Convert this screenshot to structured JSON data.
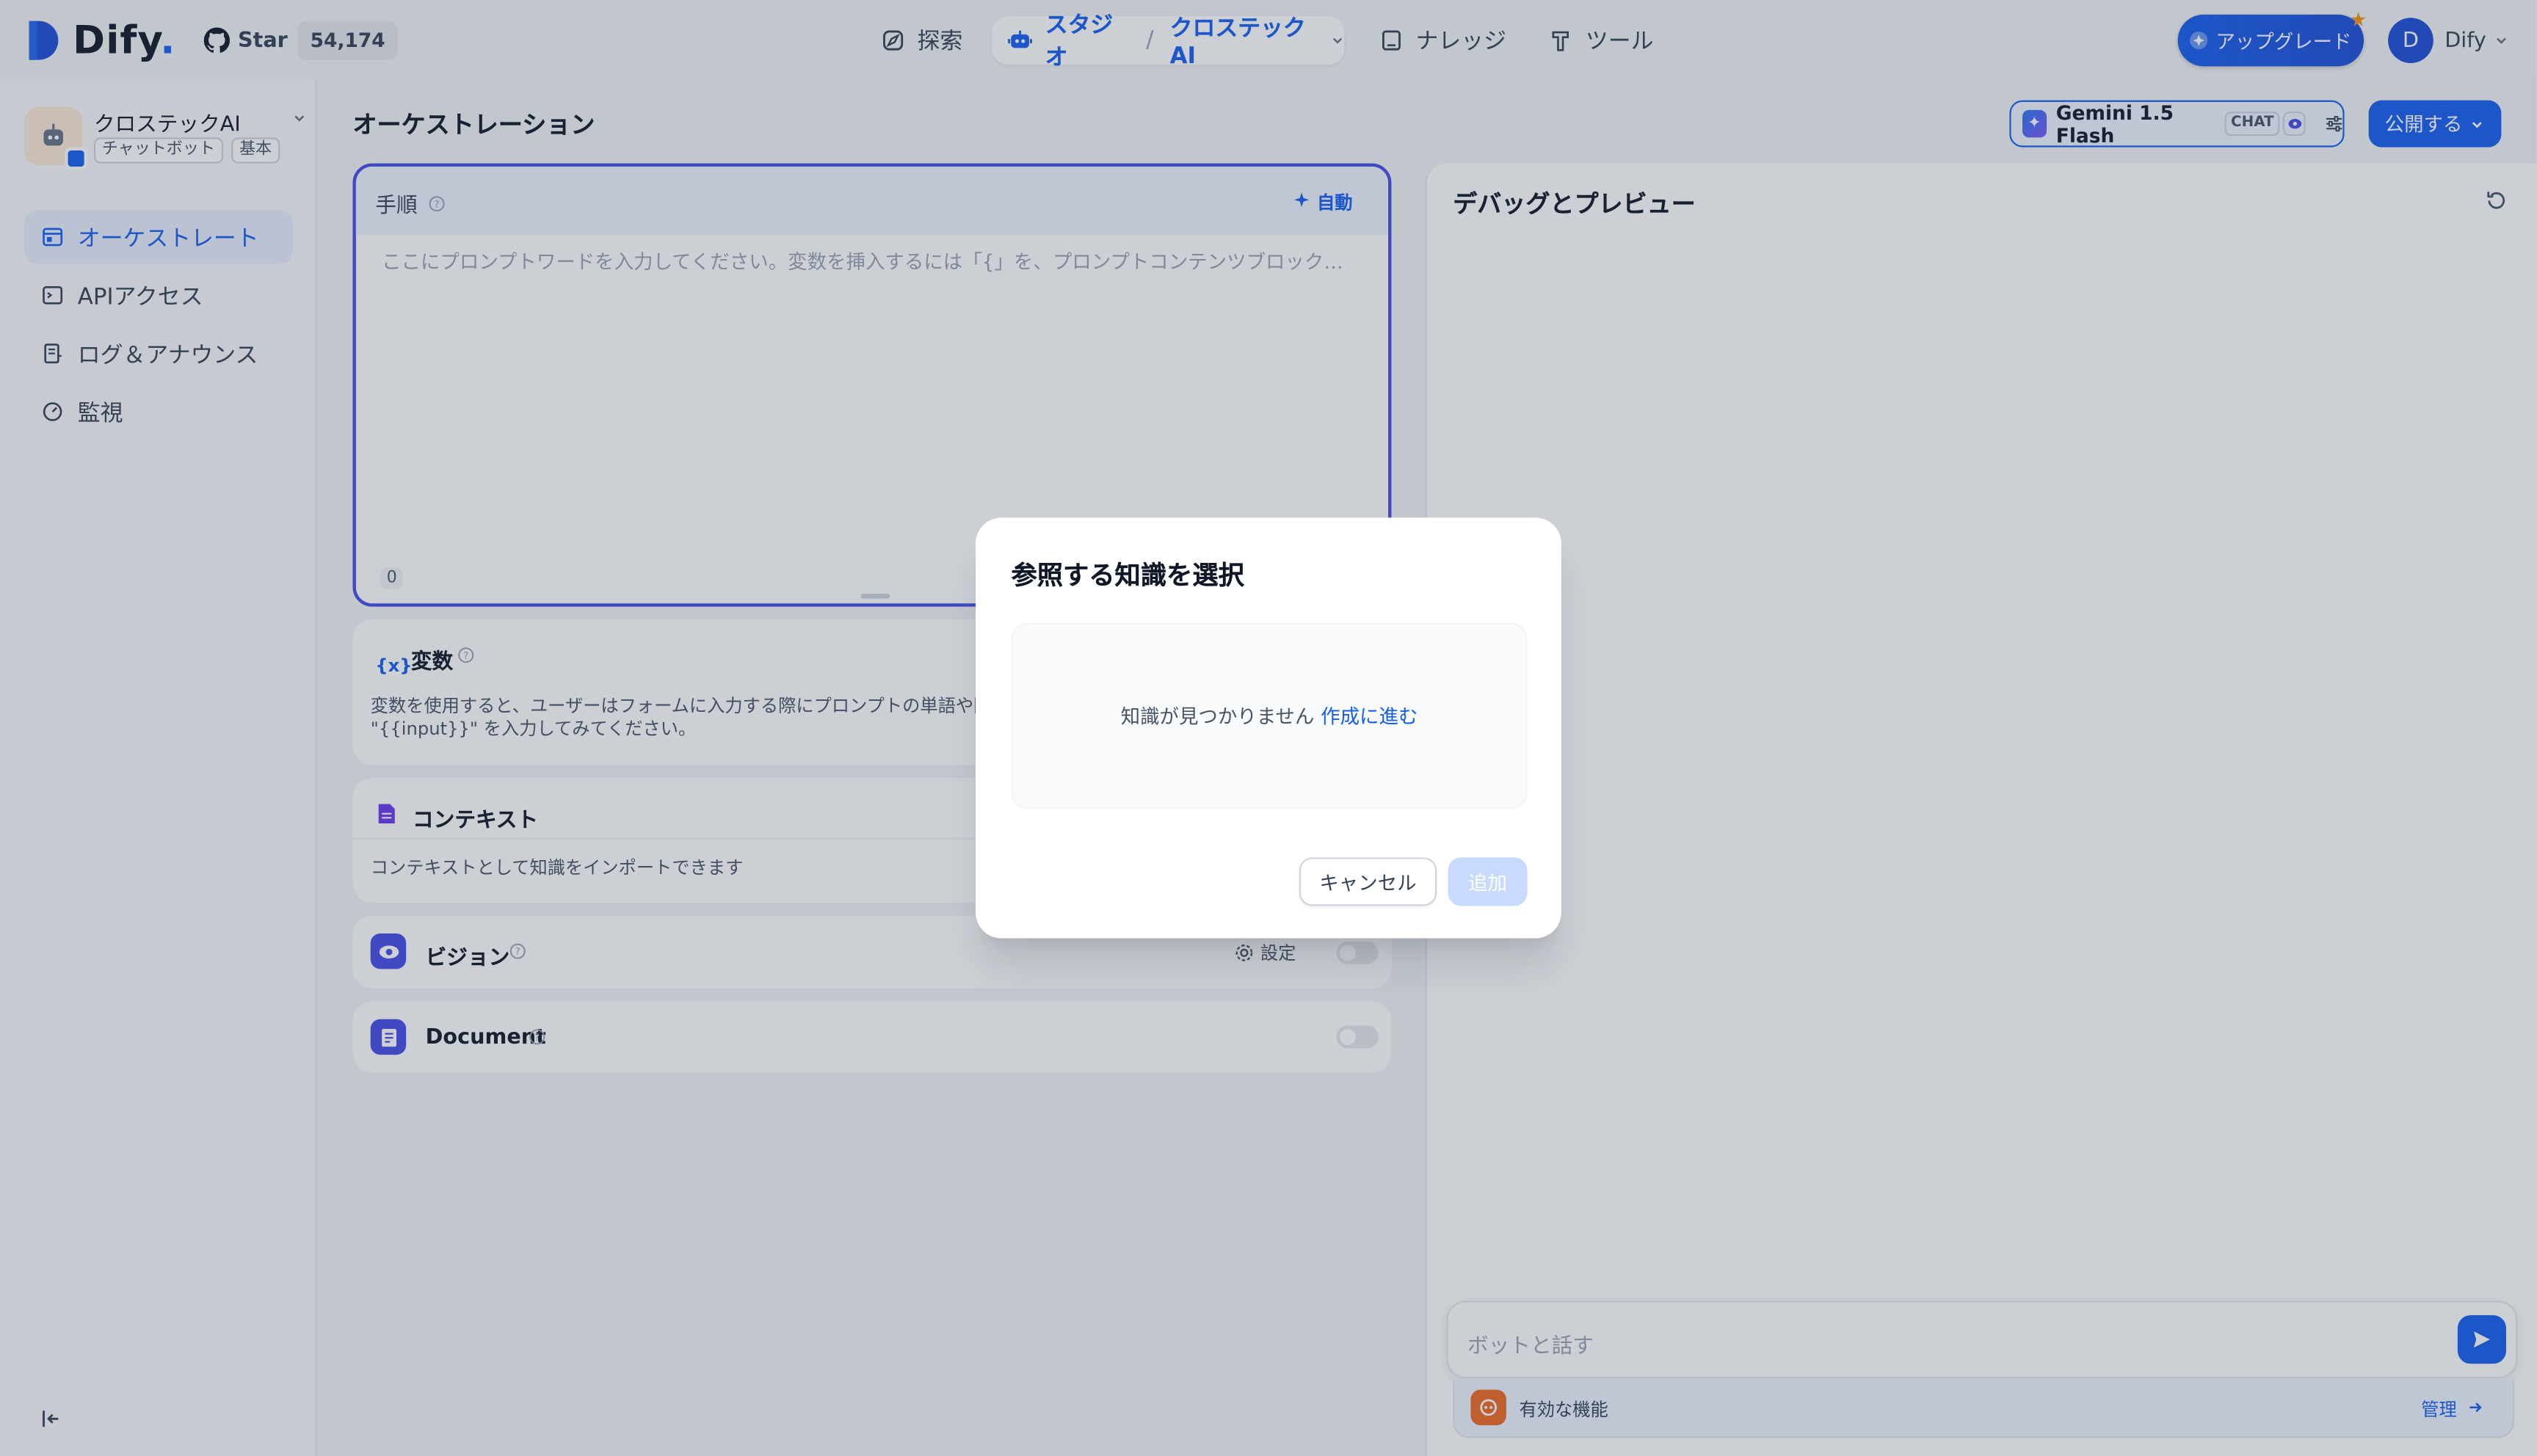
{
  "header": {
    "logo_text": "Dify",
    "github_star_label": "Star",
    "github_star_count": "54,174",
    "nav": {
      "explore": "探索",
      "studio": "スタジオ",
      "current_app": "クロステックAI",
      "knowledge": "ナレッジ",
      "tools": "ツール"
    },
    "upgrade_label": "アップグレード",
    "user_initial": "D",
    "user_name": "Dify"
  },
  "sidebar": {
    "app_name": "クロステックAI",
    "app_tags": [
      "チャットボット",
      "基本"
    ],
    "items": [
      {
        "label": "オーケストレート",
        "icon": "layout-icon",
        "active": true
      },
      {
        "label": "APIアクセス",
        "icon": "terminal-icon",
        "active": false
      },
      {
        "label": "ログ＆アナウンス",
        "icon": "file-list-icon",
        "active": false
      },
      {
        "label": "監視",
        "icon": "dashboard-icon",
        "active": false
      }
    ]
  },
  "main": {
    "title": "オーケストレーション",
    "model": {
      "name": "Gemini 1.5 Flash",
      "mode_tag": "CHAT"
    },
    "publish_label": "公開する",
    "instructions": {
      "title": "手順",
      "auto_label": "自動",
      "placeholder": "ここにプロンプトワードを入力してください。変数を挿入するには「{」を、プロンプトコンテンツブロックを挿入するには「/」を入力します。",
      "char_count": "0"
    },
    "variables": {
      "title": "変数",
      "description": "変数を使用すると、ユーザーはフォームに入力する際にプロンプトの単語や開始の挨拶を導入できます。プロンプトの単語に \"{{input}}\" を入力してみてください。"
    },
    "context": {
      "title": "コンテキスト",
      "description": "コンテキストとして知識をインポートできます"
    },
    "vision": {
      "title": "ビジョン",
      "settings_label": "設定"
    },
    "document": {
      "title": "Document"
    }
  },
  "debug": {
    "title": "デバッグとプレビュー",
    "chat_placeholder": "ボットと話す",
    "features_label": "有効な機能",
    "manage_label": "管理"
  },
  "modal": {
    "title": "参照する知識を選択",
    "empty_text": "知識が見つかりません",
    "create_link": "作成に進む",
    "cancel_label": "キャンセル",
    "add_label": "追加"
  },
  "colors": {
    "accent": "#155eef",
    "instructions_border": "#444ce7",
    "features_icon": "#ef6820",
    "upgrade_star": "#f79009"
  }
}
